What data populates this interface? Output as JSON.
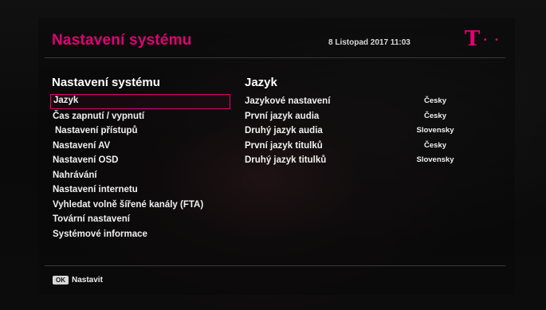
{
  "header": {
    "title": "Nastavení systému",
    "datetime": "8 Listopad 2017 11:03",
    "logo_icon": "telekom-t-logo-icon",
    "accent_color": "#e20074"
  },
  "menu": {
    "title": "Nastavení systému",
    "items": [
      {
        "label": "Jazyk",
        "selected": true
      },
      {
        "label": "Čas zapnutí / vypnutí"
      },
      {
        "label": "Nastavení přístupů"
      },
      {
        "label": "Nastavení AV"
      },
      {
        "label": "Nastavení OSD"
      },
      {
        "label": "Nahrávání"
      },
      {
        "label": "Nastavení internetu"
      },
      {
        "label": "Vyhledat volně šířené kanály (FTA)"
      },
      {
        "label": "Tovární nastavení"
      },
      {
        "label": "Systémové informace"
      }
    ]
  },
  "detail": {
    "title": "Jazyk",
    "rows": [
      {
        "label": "Jazykové nastavení",
        "value": "Česky"
      },
      {
        "label": "První jazyk audia",
        "value": "Česky"
      },
      {
        "label": "Druhý jazyk audia",
        "value": "Slovensky"
      },
      {
        "label": "První jazyk titulků",
        "value": "Česky"
      },
      {
        "label": "Druhý jazyk titulků",
        "value": "Slovensky"
      }
    ]
  },
  "footer": {
    "ok_key": "OK",
    "action_label": "Nastavit"
  }
}
